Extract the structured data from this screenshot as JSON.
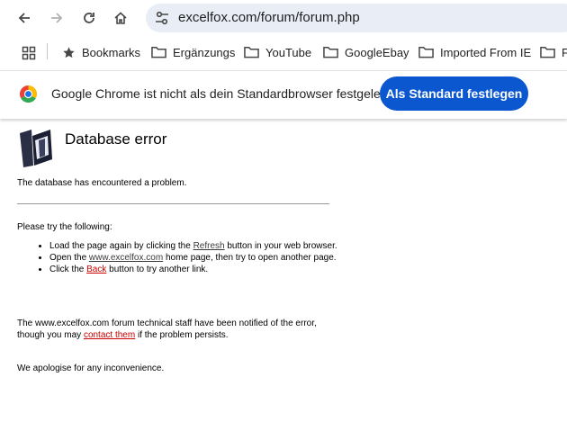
{
  "toolbar": {
    "url": "excelfox.com/forum/forum.php"
  },
  "bookmarks": {
    "items": [
      {
        "label": "Bookmarks",
        "icon": "star-icon"
      },
      {
        "label": "Ergänzungs",
        "icon": "folder-icon"
      },
      {
        "label": "YouTube",
        "icon": "folder-icon"
      },
      {
        "label": "GoogleEbay",
        "icon": "folder-icon"
      },
      {
        "label": "Imported From IE",
        "icon": "folder-icon"
      },
      {
        "label": "F",
        "icon": "folder-icon"
      }
    ]
  },
  "infobar": {
    "message": "Google Chrome ist nicht als dein Standardbrowser festgelegt",
    "button": "Als Standard festlegen",
    "button_color": "#0b57d0"
  },
  "page": {
    "title": "Database error",
    "intro": "The database has encountered a problem.",
    "try_heading": "Please try the following:",
    "items": {
      "refresh": {
        "before": "Load the page again by clicking the ",
        "link": "Refresh",
        "after": " button in your web browser."
      },
      "home": {
        "before": "Open the ",
        "link": "www.excelfox.com",
        "after": " home page, then try to open another page."
      },
      "back": {
        "before": "Click the ",
        "link": "Back",
        "after": " button to try another link."
      }
    },
    "notified": {
      "before": "The www.excelfox.com forum technical staff have been notified of the error, though you may ",
      "link": "contact them",
      "after": " if the problem persists."
    },
    "apology": "We apologise for any inconvenience.",
    "link_red": "#cc0000"
  }
}
